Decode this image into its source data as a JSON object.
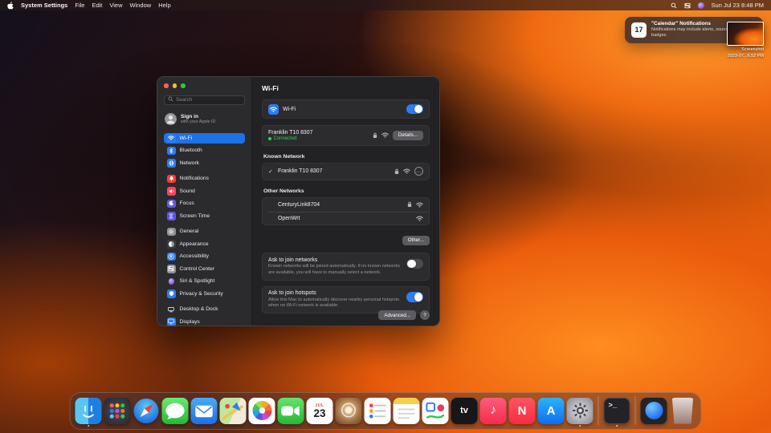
{
  "menu_bar": {
    "app_name": "System Settings",
    "menus": [
      "File",
      "Edit",
      "View",
      "Window",
      "Help"
    ],
    "clock": "Sun Jul 23 8:48 PM"
  },
  "notification": {
    "title": "\"Calendar\" Notifications",
    "body": "Notifications may include alerts, sounds, and icon badges.",
    "badge_day": "17"
  },
  "screenshot_preview": {
    "label": "Screenshot",
    "filename": "2023-07...6.52 PM"
  },
  "window": {
    "sidebar": {
      "search_placeholder": "Search",
      "apple_id": {
        "title": "Sign in",
        "subtitle": "with your Apple ID"
      },
      "items": [
        {
          "label": "Wi-Fi"
        },
        {
          "label": "Bluetooth"
        },
        {
          "label": "Network"
        },
        {
          "label": "Notifications"
        },
        {
          "label": "Sound"
        },
        {
          "label": "Focus"
        },
        {
          "label": "Screen Time"
        },
        {
          "label": "General"
        },
        {
          "label": "Appearance"
        },
        {
          "label": "Accessibility"
        },
        {
          "label": "Control Center"
        },
        {
          "label": "Siri & Spotlight"
        },
        {
          "label": "Privacy & Security"
        },
        {
          "label": "Desktop & Dock"
        },
        {
          "label": "Displays"
        }
      ]
    },
    "content": {
      "title": "Wi-Fi",
      "wifi_toggle_label": "Wi-Fi",
      "wifi_toggle_state": "on",
      "connected": {
        "name": "Franklin T10 8307",
        "status": "Connected",
        "details_button": "Details..."
      },
      "known_heading": "Known Network",
      "known_check": "✓",
      "known": {
        "name": "Franklin T10 8307"
      },
      "more_button": "…",
      "other_heading": "Other Networks",
      "other_networks": [
        {
          "name": "CenturyLink8704",
          "secured": true
        },
        {
          "name": "OpenWrt",
          "secured": false
        }
      ],
      "other_button": "Other...",
      "ask_networks": {
        "label": "Ask to join networks",
        "description": "Known networks will be joined automatically. If no known networks are available, you will have to manually select a network.",
        "state": "off"
      },
      "ask_hotspots": {
        "label": "Ask to join hotspots",
        "description": "Allow this Mac to automatically discover nearby personal hotspots when no Wi-Fi network is available.",
        "state": "on"
      },
      "advanced_button": "Advanced...",
      "help_button": "?"
    }
  },
  "dock": {
    "items": [
      "finder",
      "launchpad",
      "safari",
      "messages",
      "mail",
      "maps",
      "photos",
      "facetime",
      "calendar",
      "photo-booth",
      "reminders",
      "notes",
      "freeform",
      "tv",
      "music",
      "news",
      "app-store",
      "settings",
      "terminal",
      "downloads",
      "trash"
    ],
    "calendar": {
      "month": "JUL",
      "day": "23"
    },
    "glyphs": {
      "tv": "tv",
      "news": "N",
      "app_store": "A",
      "terminal": ">_",
      "music": "♪"
    }
  },
  "colors": {
    "accent": "#2a7cf7",
    "toggle_on": "#2f7cf6",
    "connected_green": "#30d158",
    "sidebar_selected": "#2071e5"
  }
}
